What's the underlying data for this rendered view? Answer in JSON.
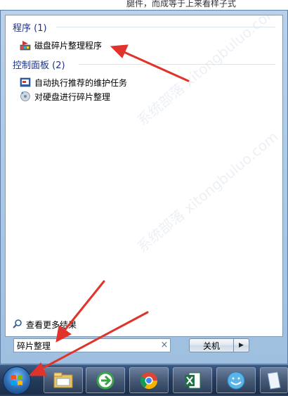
{
  "background": {
    "text": "腿件，而成等于上来看样子式"
  },
  "menu": {
    "programs_header": "程序 (1)",
    "programs": [
      {
        "label": "磁盘碎片整理程序",
        "icon": "defrag-icon"
      }
    ],
    "control_panel_header": "控制面板 (2)",
    "control_panel": [
      {
        "label": "自动执行推荐的维护任务",
        "icon": "maintenance-icon"
      },
      {
        "label": "对硬盘进行碎片整理",
        "icon": "disk-defrag-icon"
      }
    ],
    "see_more": "查看更多结果"
  },
  "search": {
    "value": "碎片整理",
    "clear": "×"
  },
  "shutdown": {
    "label": "关机",
    "arrow": "▶"
  },
  "watermark": {
    "text": "系统部落 xitongbuluo.com"
  },
  "taskbar": {
    "items": [
      {
        "name": "file-explorer-icon"
      },
      {
        "name": "ie-icon"
      },
      {
        "name": "chrome-icon"
      },
      {
        "name": "excel-icon"
      },
      {
        "name": "app-icon"
      },
      {
        "name": "document-icon"
      }
    ]
  },
  "colors": {
    "header": "#1e3287",
    "annotation": "#e0332b"
  }
}
